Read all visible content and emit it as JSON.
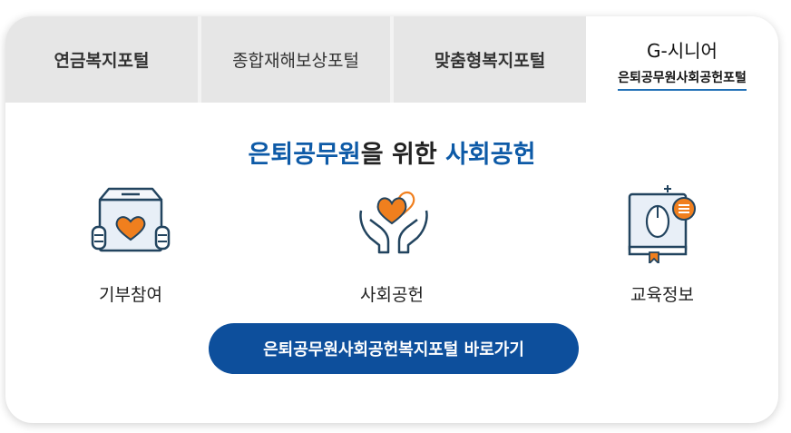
{
  "tabs": [
    {
      "label": "연금복지포털"
    },
    {
      "label": "종합재해보상포털"
    },
    {
      "label": "맞춤형복지포털"
    },
    {
      "label": "G-시니어",
      "sublabel": "은퇴공무원사회공헌포털"
    }
  ],
  "headline": {
    "part1": "은퇴공무원",
    "part2": "을 위한 ",
    "part3": "사회공헌"
  },
  "features": [
    {
      "label": "기부참여",
      "icon": "donation-box-icon"
    },
    {
      "label": "사회공헌",
      "icon": "caring-hands-icon"
    },
    {
      "label": "교육정보",
      "icon": "education-book-icon"
    }
  ],
  "cta": {
    "label": "은퇴공무원사회공헌복지포털 바로가기"
  },
  "colors": {
    "brand_blue": "#0d5aa7",
    "accent_orange": "#f07f1e",
    "button_blue": "#0d4f9c"
  }
}
